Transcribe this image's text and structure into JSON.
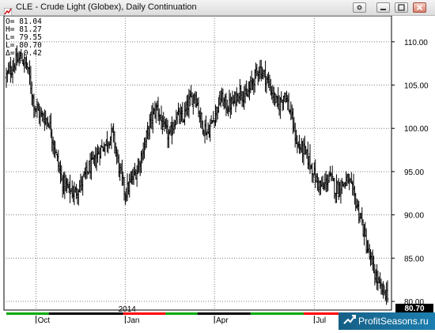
{
  "window": {
    "title": "CLE - Crude Light (Globex), Daily Continuation",
    "buttons": [
      "settings",
      "minimize",
      "maximize",
      "close"
    ]
  },
  "ohlc": [
    {
      "label": "O=",
      "value": "81.04"
    },
    {
      "label": "H=",
      "value": "81.27"
    },
    {
      "label": "L=",
      "value": "79.55"
    },
    {
      "label": "L=",
      "value": "80.70"
    },
    {
      "label": "Δ=",
      "value": "-0.42"
    }
  ],
  "last_price_tag": "80.70",
  "watermark": "ProfitSeasons.ru",
  "colors": {
    "up": "#ff0000",
    "down": "#00aa00",
    "neutral": "#000000",
    "grid": "#808080"
  },
  "chart_data": {
    "type": "ohlc",
    "instrument": "CLE - Crude Light (Globex)",
    "period": "Daily Continuation",
    "ylim": [
      79,
      113
    ],
    "y_ticks": [
      "80.00",
      "85.00",
      "90.00",
      "95.00",
      "100.00",
      "105.00",
      "110.00"
    ],
    "x_tick_labels": [
      "Oct",
      "Jan",
      "Apr",
      "Jul"
    ],
    "year_label": "2014",
    "trend_points": [
      [
        0,
        106.0
      ],
      [
        8,
        107.5
      ],
      [
        14,
        108.2
      ],
      [
        20,
        107.0
      ],
      [
        26,
        102.8
      ],
      [
        32,
        101.5
      ],
      [
        40,
        100.8
      ],
      [
        46,
        97.5
      ],
      [
        52,
        94.0
      ],
      [
        58,
        93.0
      ],
      [
        64,
        92.5
      ],
      [
        70,
        93.5
      ],
      [
        76,
        95.0
      ],
      [
        82,
        96.0
      ],
      [
        88,
        97.5
      ],
      [
        94,
        98.3
      ],
      [
        100,
        99.5
      ],
      [
        106,
        95.5
      ],
      [
        112,
        92.5
      ],
      [
        118,
        94.0
      ],
      [
        124,
        95.5
      ],
      [
        130,
        98.0
      ],
      [
        136,
        101.0
      ],
      [
        142,
        102.5
      ],
      [
        148,
        100.0
      ],
      [
        154,
        99.0
      ],
      [
        160,
        101.5
      ],
      [
        166,
        101.0
      ],
      [
        172,
        103.0
      ],
      [
        178,
        104.0
      ],
      [
        184,
        100.5
      ],
      [
        190,
        99.5
      ],
      [
        196,
        101.5
      ],
      [
        202,
        103.5
      ],
      [
        208,
        102.5
      ],
      [
        214,
        103.0
      ],
      [
        220,
        104.5
      ],
      [
        226,
        103.5
      ],
      [
        232,
        105.5
      ],
      [
        238,
        107.0
      ],
      [
        244,
        106.0
      ],
      [
        250,
        104.2
      ],
      [
        256,
        102.5
      ],
      [
        262,
        104.2
      ],
      [
        268,
        101.5
      ],
      [
        274,
        98.0
      ],
      [
        280,
        97.5
      ],
      [
        286,
        96.0
      ],
      [
        292,
        94.0
      ],
      [
        298,
        93.0
      ],
      [
        304,
        94.5
      ],
      [
        310,
        93.0
      ],
      [
        316,
        93.5
      ],
      [
        322,
        94.0
      ],
      [
        328,
        92.0
      ],
      [
        334,
        89.5
      ],
      [
        340,
        86.0
      ],
      [
        346,
        83.5
      ],
      [
        352,
        81.5
      ],
      [
        358,
        80.9
      ]
    ],
    "bar_count": 360
  }
}
